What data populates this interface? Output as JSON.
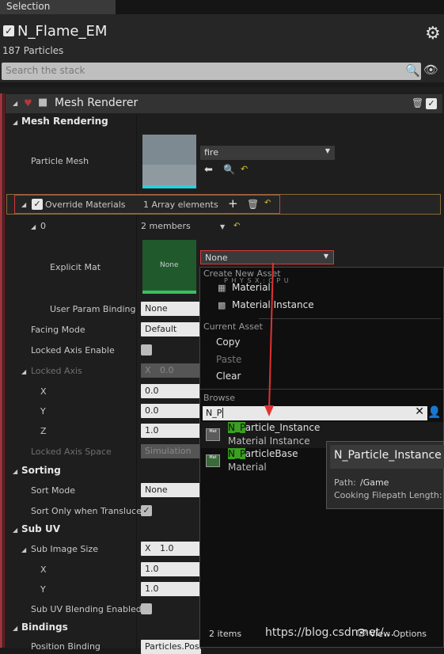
{
  "tab": {
    "title": "Selection"
  },
  "emitter": {
    "name": "N_Flame_EM",
    "particles": "187 Particles"
  },
  "search": {
    "placeholder": "Search the stack"
  },
  "renderer": {
    "title": "Mesh Renderer"
  },
  "sections": {
    "mesh_rendering": "Mesh Rendering",
    "sorting": "Sorting",
    "sub_uv": "Sub UV",
    "bindings": "Bindings"
  },
  "properties": {
    "particle_mesh": {
      "label": "Particle Mesh",
      "value": "fire"
    },
    "override_materials": {
      "label": "Override Materials",
      "value": "1 Array elements"
    },
    "element0": {
      "label": "0",
      "value": "2 members"
    },
    "explicit_mat": {
      "label": "Explicit Mat",
      "value": "None",
      "thumb": "None"
    },
    "user_param": {
      "label": "User Param Binding",
      "value": "None"
    },
    "facing_mode": {
      "label": "Facing Mode",
      "value": "Default"
    },
    "locked_axis_enable": {
      "label": "Locked Axis Enable"
    },
    "locked_axis": {
      "label": "Locked Axis",
      "x_prefix": "X",
      "x": "0.0"
    },
    "lx": {
      "label": "X",
      "value": "0.0"
    },
    "ly": {
      "label": "Y",
      "value": "0.0"
    },
    "lz": {
      "label": "Z",
      "value": "1.0"
    },
    "locked_axis_space": {
      "label": "Locked Axis Space",
      "value": "Simulation"
    },
    "sort_mode": {
      "label": "Sort Mode",
      "value": "None"
    },
    "sort_only": {
      "label": "Sort Only when Transluce"
    },
    "sub_image_size": {
      "label": "Sub Image Size",
      "x_prefix": "X",
      "x": "1.0"
    },
    "sx": {
      "label": "X",
      "value": "1.0"
    },
    "sy": {
      "label": "Y",
      "value": "1.0"
    },
    "sub_uv_blend": {
      "label": "Sub UV Blending Enabled"
    },
    "position_binding": {
      "label": "Position Binding",
      "value": "Particles.Posit"
    }
  },
  "menu": {
    "create_header": "Create New Asset",
    "create_items": [
      "Material",
      "Material Instance"
    ],
    "current_header": "Current Asset",
    "current_items": [
      "Copy",
      "Paste",
      "Clear"
    ],
    "browse_header": "Browse",
    "search_value": "N_P",
    "results": [
      {
        "match": "N_P",
        "name": "article_Instance",
        "type": "Material Instance"
      },
      {
        "match": "N_P",
        "name": "articleBase",
        "type": "Material"
      }
    ],
    "count": "2 items",
    "view_options": "View Options",
    "phys": "P H Y S X : C P U"
  },
  "tooltip": {
    "title": "N_Particle_Instance",
    "path_label": "Path:",
    "path_value": "/Game",
    "cook_label": "Cooking Filepath Length:"
  },
  "watermark": "https://blog.csdn.net/...",
  "colors": {
    "accent_red": "#d23a3a",
    "highlight_green": "#3aa020",
    "check": "#e8e8e8"
  }
}
